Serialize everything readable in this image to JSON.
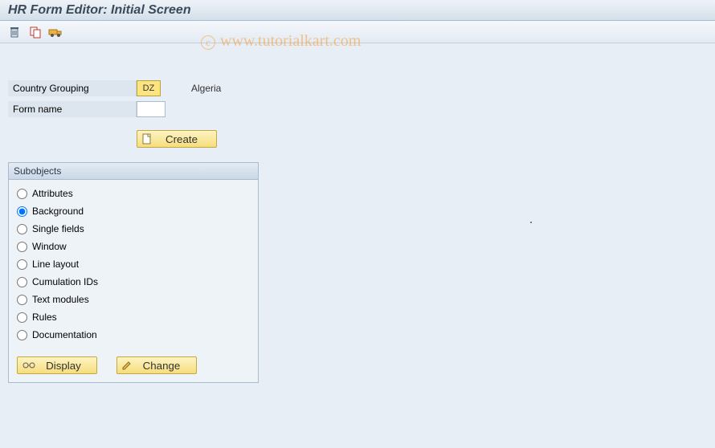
{
  "title": "HR Form Editor: Initial Screen",
  "watermark": "www.tutorialkart.com",
  "labels": {
    "country_grouping": "Country Grouping",
    "form_name": "Form name"
  },
  "country": {
    "code": "DZ",
    "name": "Algeria"
  },
  "form_name_value": "",
  "buttons": {
    "create": "Create",
    "display": "Display",
    "change": "Change"
  },
  "subobjects": {
    "title": "Subobjects",
    "options": [
      "Attributes",
      "Background",
      "Single fields",
      "Window",
      "Line layout",
      "Cumulation IDs",
      "Text modules",
      "Rules",
      "Documentation"
    ],
    "selected_index": 1
  },
  "toolbar_icons": [
    "delete-icon",
    "copy-icon",
    "transport-icon"
  ]
}
